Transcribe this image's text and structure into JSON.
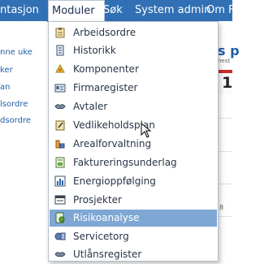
{
  "menubar": {
    "items": [
      {
        "label": "ntasjon"
      },
      {
        "label": "Moduler"
      },
      {
        "label": "Søk"
      },
      {
        "label": "System admin"
      },
      {
        "label": "Om F"
      }
    ]
  },
  "left_panel": {
    "links": [
      "nne uke",
      "ker",
      "an",
      "lsordre",
      "dsordre"
    ]
  },
  "right_panel": {
    "title": "s p",
    "subtitle": "nest",
    "calendar_day": "1",
    "value": "8"
  },
  "dropdown": {
    "items": [
      {
        "label": "Arbeidsordre",
        "icon": "clipboard-icon"
      },
      {
        "label": "Historikk",
        "icon": "history-document-icon"
      },
      {
        "label": "Komponenter",
        "icon": "component-icon"
      },
      {
        "label": "Firmaregister",
        "icon": "company-card-icon"
      },
      {
        "label": "Avtaler",
        "icon": "agreement-icon"
      },
      {
        "label": "Vedlikeholdsplan",
        "icon": "maintenance-plan-icon"
      },
      {
        "label": "Arealforvaltning",
        "icon": "area-management-icon"
      },
      {
        "label": "Faktureringsunderlag",
        "icon": "invoice-icon"
      },
      {
        "label": "Energioppfølging",
        "icon": "energy-chart-icon"
      },
      {
        "label": "Prosjekter",
        "icon": "project-icon"
      },
      {
        "label": "Risikoanalyse",
        "icon": "risk-analysis-icon"
      },
      {
        "label": "Servicetorg",
        "icon": "service-desk-icon"
      },
      {
        "label": "Utlånsregister",
        "icon": "loan-register-icon"
      }
    ],
    "selected_label": "Risikoanalyse"
  },
  "colors": {
    "menubar_bg": "#3170b4",
    "selected_bg": "#7ea7d5",
    "link": "#1f5ea8"
  }
}
